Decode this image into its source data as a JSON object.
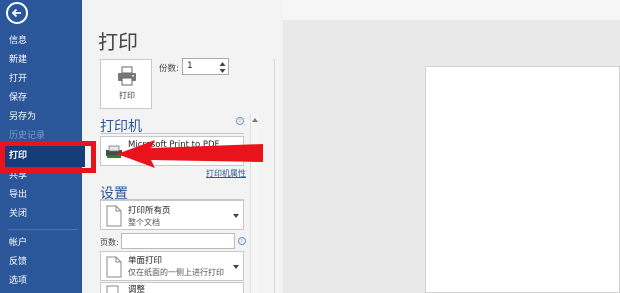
{
  "sidebar": {
    "items": [
      {
        "label": "信息"
      },
      {
        "label": "新建"
      },
      {
        "label": "打开"
      },
      {
        "label": "保存"
      },
      {
        "label": "另存为"
      },
      {
        "label": "历史记录",
        "disabled": true
      },
      {
        "label": "打印",
        "selected": true
      },
      {
        "label": "共享"
      },
      {
        "label": "导出"
      },
      {
        "label": "关闭"
      },
      {
        "label": "帐户"
      },
      {
        "label": "反馈"
      },
      {
        "label": "选项"
      }
    ]
  },
  "main": {
    "title": "打印",
    "print_button_label": "打印",
    "copies_label": "份数:",
    "copies_value": "1",
    "printer": {
      "section_title": "打印机",
      "name": "Microsoft Print to PDF",
      "properties_link": "打印机属性"
    },
    "settings": {
      "section_title": "设置",
      "print_range": {
        "title": "打印所有页",
        "subtitle": "整个文档"
      },
      "pages_label": "页数:",
      "sides": {
        "title": "单面打印",
        "subtitle": "仅在纸面的一侧上进行打印"
      },
      "collate": {
        "title": "调整"
      }
    }
  },
  "colors": {
    "sidebar": "#2b579a",
    "selected": "#173d78",
    "accent": "#2b579a",
    "annotation": "#e8131b"
  }
}
